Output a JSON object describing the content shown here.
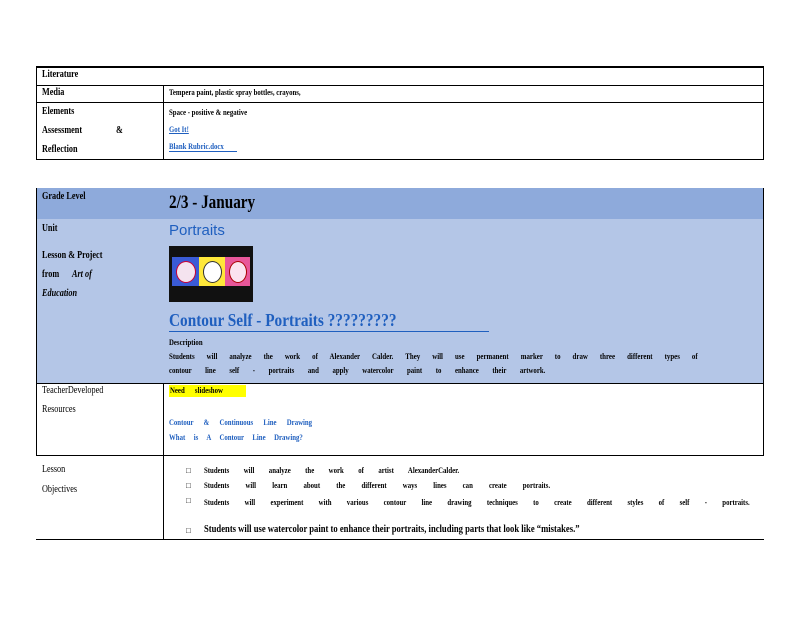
{
  "top_table": {
    "literature_label": "Literature",
    "media_label": "Media",
    "media_value": "Tempera paint, plastic spray bottles, crayons,",
    "elements_label": "Elements",
    "elements_value": "Space - positive & negative",
    "assessment_label_1": "Assessment",
    "assessment_label_amp": "&",
    "assessment_label_2": "Reflection",
    "link_got_it": "Got It!",
    "link_rubric": "Blank Rubric.docx"
  },
  "grade": {
    "label": "Grade Level",
    "value": "2/3 - January"
  },
  "unit": {
    "label": "Unit",
    "value": "Portraits"
  },
  "lesson": {
    "label_line1": "Lesson & Project",
    "label_line2_a": "from",
    "label_line2_b": "Art of",
    "label_line3": "Education",
    "title": "Contour Self - Portraits ?????????",
    "description_heading": "Description",
    "description_line1": "Students will analyze the work of Alexander Calder. They will use permanent marker to draw three different types of",
    "description_line2": "contour line self - portraits and apply watercolor paint to enhance their artwork."
  },
  "resources": {
    "label_line1": "TeacherDeveloped",
    "label_line2": "Resources",
    "highlight": "Need slideshow",
    "link1": "Contour & Continuous Line Drawing",
    "link2": "What is A Contour Line Drawing?"
  },
  "objectives": {
    "label_line1": "Lesson",
    "label_line2": "Objectives",
    "bullet": "□",
    "items": [
      "Students will analyze the work of artist AlexanderCalder.",
      "Students will learn about the different ways lines can create portraits.",
      "Students will experiment with various contour line drawing techniques to create different styles of self - portraits.",
      "Students will use watercolor paint to enhance their portraits, including parts that look like “mistakes.”"
    ]
  },
  "colors": {
    "grade_band": "#8eaadb",
    "lesson_band": "#b4c6e7",
    "link": "#1f5fbf",
    "highlight": "#ffff00"
  }
}
